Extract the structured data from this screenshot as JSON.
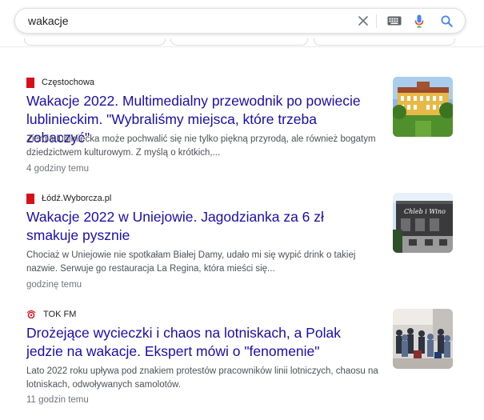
{
  "search": {
    "value": "wakacje",
    "icons": [
      "close-icon",
      "keyboard-icon",
      "microphone-icon",
      "search-icon"
    ]
  },
  "colors": {
    "link": "#1a0dab",
    "snippet": "#4d5156",
    "meta": "#70757a",
    "search_blue": "#4285f4",
    "wyborcza_red": "#d6101a"
  },
  "results": [
    {
      "source": "Częstochowa",
      "title": "Wakacje 2022. Multimedialny przewodnik po powiecie lublinieckim. \"Wybraliśmy miejsca, które trzeba zobaczyć\"",
      "snippet": "Ziemia lubliniecka może pochwalić się nie tylko piękną przyrodą, ale również bogatym dziedzictwem kulturowym. Z myślą o krótkich,...",
      "time": "4 godziny temu"
    },
    {
      "source": "Łódź.Wyborcza.pl",
      "title": "Wakacje 2022 w Uniejowie. Jagodzianka za 6 zł smakuje pysznie",
      "snippet": "Chociaż w Uniejowie nie spotkałam Białej Damy, udało mi się wypić drink o takiej nazwie. Serwuje go restauracja La Regina, która mieści się...",
      "time": "godzinę temu",
      "thumb_sign": "Chleb i Wino"
    },
    {
      "source": "TOK FM",
      "title": "Drożejące wycieczki i chaos na lotniskach, a Polak jedzie na wakacje. Ekspert mówi o \"fenomenie\"",
      "snippet": "Lato 2022 roku upływa pod znakiem protestów pracowników linii lotniczych, chaosu na lotniskach, odwoływanych samolotów.",
      "time": "11 godzin temu"
    }
  ]
}
